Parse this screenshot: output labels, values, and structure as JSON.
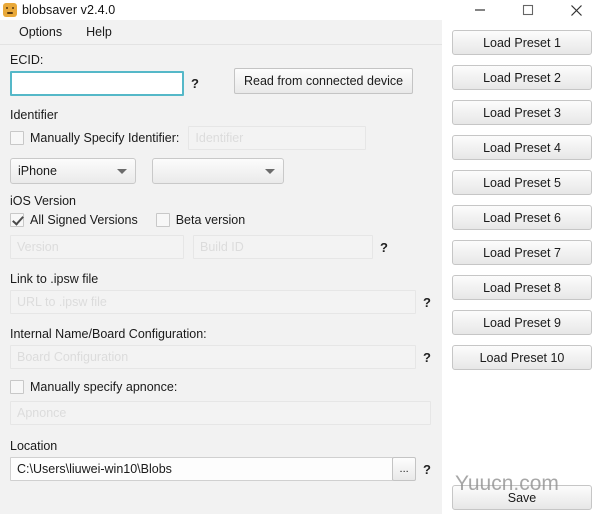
{
  "window": {
    "title": "blobsaver v2.4.0",
    "icon": "blobsaver-app-icon",
    "controls": {
      "minimize": "minimize-icon",
      "maximize": "maximize-icon",
      "close": "close-icon"
    }
  },
  "menubar": {
    "items": [
      {
        "label": "Options"
      },
      {
        "label": "Help"
      }
    ]
  },
  "form": {
    "ecid": {
      "label": "ECID:",
      "value": "",
      "placeholder": "",
      "help": "?",
      "focused": true
    },
    "read_device_button": "Read from connected device",
    "identifier": {
      "section_label": "Identifier",
      "manual_checkbox_label": "Manually Specify Identifier:",
      "manual_checked": false,
      "input_value": "",
      "input_placeholder": "Identifier",
      "device_type_value": "iPhone",
      "device_model_value": ""
    },
    "ios_version": {
      "section_label": "iOS Version",
      "all_signed_label": "All Signed Versions",
      "all_signed_checked": true,
      "beta_label": "Beta version",
      "beta_checked": false,
      "version_value": "",
      "version_placeholder": "Version",
      "build_id_value": "",
      "build_id_placeholder": "Build ID",
      "help": "?"
    },
    "ipsw": {
      "label": "Link to .ipsw file",
      "value": "",
      "placeholder": "URL to .ipsw file",
      "help": "?"
    },
    "board_config": {
      "label": "Internal Name/Board Configuration:",
      "value": "",
      "placeholder": "Board Configuration",
      "help": "?"
    },
    "apnonce": {
      "checkbox_label": "Manually specify apnonce:",
      "checked": false,
      "value": "",
      "placeholder": "Apnonce"
    },
    "location": {
      "label": "Location",
      "value": "C:\\Users\\liuwei-win10\\Blobs",
      "placeholder": "",
      "browse_button": "...",
      "help": "?"
    }
  },
  "presets": {
    "buttons": [
      "Load Preset 1",
      "Load Preset 2",
      "Load Preset 3",
      "Load Preset 4",
      "Load Preset 5",
      "Load Preset 6",
      "Load Preset 7",
      "Load Preset 8",
      "Load Preset 9",
      "Load Preset 10"
    ],
    "save_button": "Save"
  },
  "watermark": "Yuucn.com",
  "colors": {
    "left_panel_bg": "#f2f2f2",
    "right_panel_bg": "#ffffff",
    "focus_border": "#55b8c8",
    "app_icon": "#e9a93a"
  }
}
